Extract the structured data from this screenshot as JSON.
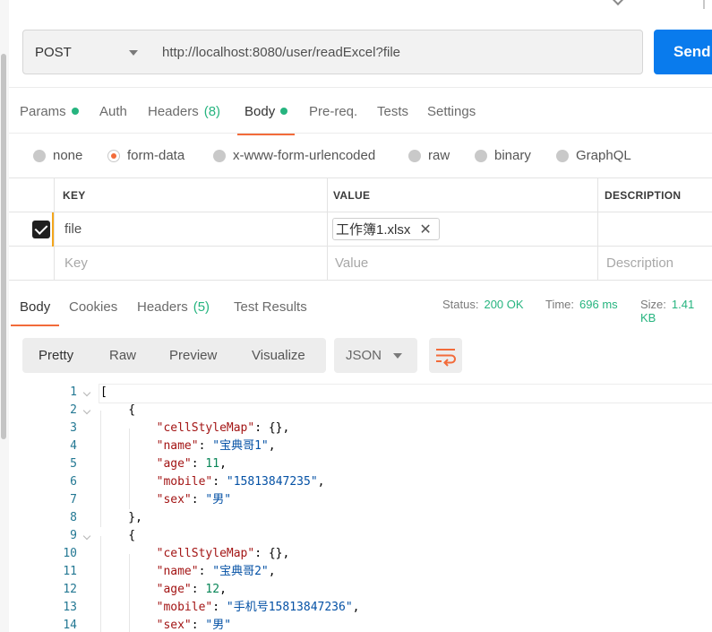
{
  "request": {
    "method": "POST",
    "url": "http://localhost:8080/user/readExcel?file",
    "send_label": "Send"
  },
  "request_tabs": [
    {
      "label": "Params",
      "indicator": "green-dot"
    },
    {
      "label": "Auth"
    },
    {
      "label": "Headers",
      "count": "(8)"
    },
    {
      "label": "Body",
      "indicator": "green-dot",
      "active": true
    },
    {
      "label": "Pre-req."
    },
    {
      "label": "Tests"
    },
    {
      "label": "Settings"
    }
  ],
  "body_types": [
    {
      "label": "none",
      "selected": false
    },
    {
      "label": "form-data",
      "selected": true
    },
    {
      "label": "x-www-form-urlencoded",
      "selected": false
    },
    {
      "label": "raw",
      "selected": false
    },
    {
      "label": "binary",
      "selected": false
    },
    {
      "label": "GraphQL",
      "selected": false
    }
  ],
  "table": {
    "headers": {
      "key": "KEY",
      "value": "VALUE",
      "description": "DESCRIPTION"
    },
    "rows": [
      {
        "checked": true,
        "key": "file",
        "value": "工作簿1.xlsx",
        "description": ""
      }
    ],
    "placeholders": {
      "key": "Key",
      "value": "Value",
      "description": "Description"
    }
  },
  "response_tabs": [
    {
      "label": "Body",
      "active": true
    },
    {
      "label": "Cookies"
    },
    {
      "label": "Headers",
      "count": "(5)"
    },
    {
      "label": "Test Results"
    }
  ],
  "status": {
    "status_label": "Status:",
    "status_value": "200 OK",
    "time_label": "Time:",
    "time_value": "696 ms",
    "size_label": "Size:",
    "size_value": "1.41 KB"
  },
  "view_modes": [
    "Pretty",
    "Raw",
    "Preview",
    "Visualize"
  ],
  "format": "JSON",
  "colors": {
    "accent": "#f26b3a",
    "send": "#097bed",
    "ok": "#26b47f"
  },
  "icons": {
    "wrap": "wrap-lines-icon",
    "format_caret": "chevron-down-icon",
    "remove": "close-icon",
    "checkbox": "check-icon"
  },
  "code_lines": [
    {
      "n": "1",
      "text": "["
    },
    {
      "n": "2",
      "text": "    {"
    },
    {
      "n": "3",
      "text": "        \"cellStyleMap\": {},"
    },
    {
      "n": "4",
      "text": "        \"name\": \"宝典哥1\","
    },
    {
      "n": "5",
      "text": "        \"age\": 11,"
    },
    {
      "n": "6",
      "text": "        \"mobile\": \"15813847235\","
    },
    {
      "n": "7",
      "text": "        \"sex\": \"男\""
    },
    {
      "n": "8",
      "text": "    },"
    },
    {
      "n": "9",
      "text": "    {"
    },
    {
      "n": "10",
      "text": "        \"cellStyleMap\": {},"
    },
    {
      "n": "11",
      "text": "        \"name\": \"宝典哥2\","
    },
    {
      "n": "12",
      "text": "        \"age\": 12,"
    },
    {
      "n": "13",
      "text": "        \"mobile\": \"手机号15813847236\","
    },
    {
      "n": "14",
      "text": "        \"sex\": \"男\""
    }
  ]
}
